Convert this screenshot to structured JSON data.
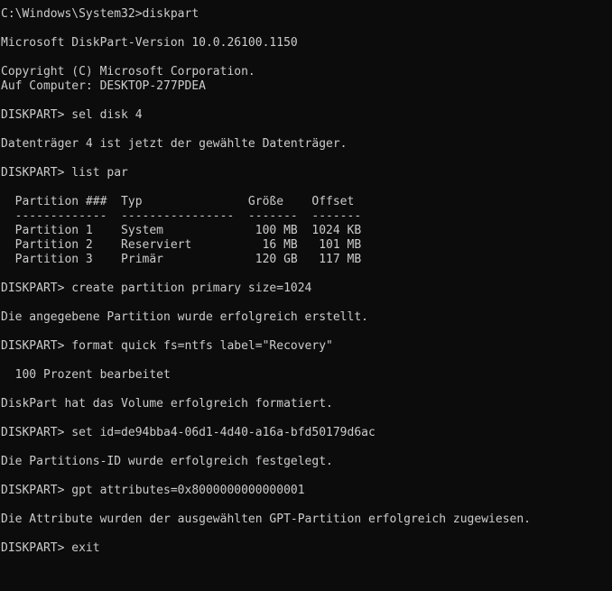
{
  "console": {
    "line_01": "C:\\Windows\\System32>diskpart",
    "line_02": "Microsoft DiskPart-Version 10.0.26100.1150",
    "line_03": "Copyright (C) Microsoft Corporation.",
    "line_04": "Auf Computer: DESKTOP-277PDEA",
    "line_05": "DISKPART> sel disk 4",
    "line_06": "Datenträger 4 ist jetzt der gewählte Datenträger.",
    "line_07": "DISKPART> list par",
    "table": {
      "header": "  Partition ###  Typ               Größe    Offset",
      "separator": "  -------------  ----------------  -------  -------",
      "rows": [
        "  Partition 1    System             100 MB  1024 KB",
        "  Partition 2    Reserviert          16 MB   101 MB",
        "  Partition 3    Primär             120 GB   117 MB"
      ]
    },
    "line_08": "DISKPART> create partition primary size=1024",
    "line_09": "Die angegebene Partition wurde erfolgreich erstellt.",
    "line_10": "DISKPART> format quick fs=ntfs label=\"Recovery\"",
    "line_11": "  100 Prozent bearbeitet",
    "line_12": "DiskPart hat das Volume erfolgreich formatiert.",
    "line_13": "DISKPART> set id=de94bba4-06d1-4d40-a16a-bfd50179d6ac",
    "line_14": "Die Partitions-ID wurde erfolgreich festgelegt.",
    "line_15": "DISKPART> gpt attributes=0x8000000000000001",
    "line_16": "Die Attribute wurden der ausgewählten GPT-Partition erfolgreich zugewiesen.",
    "line_17": "DISKPART> exit"
  }
}
